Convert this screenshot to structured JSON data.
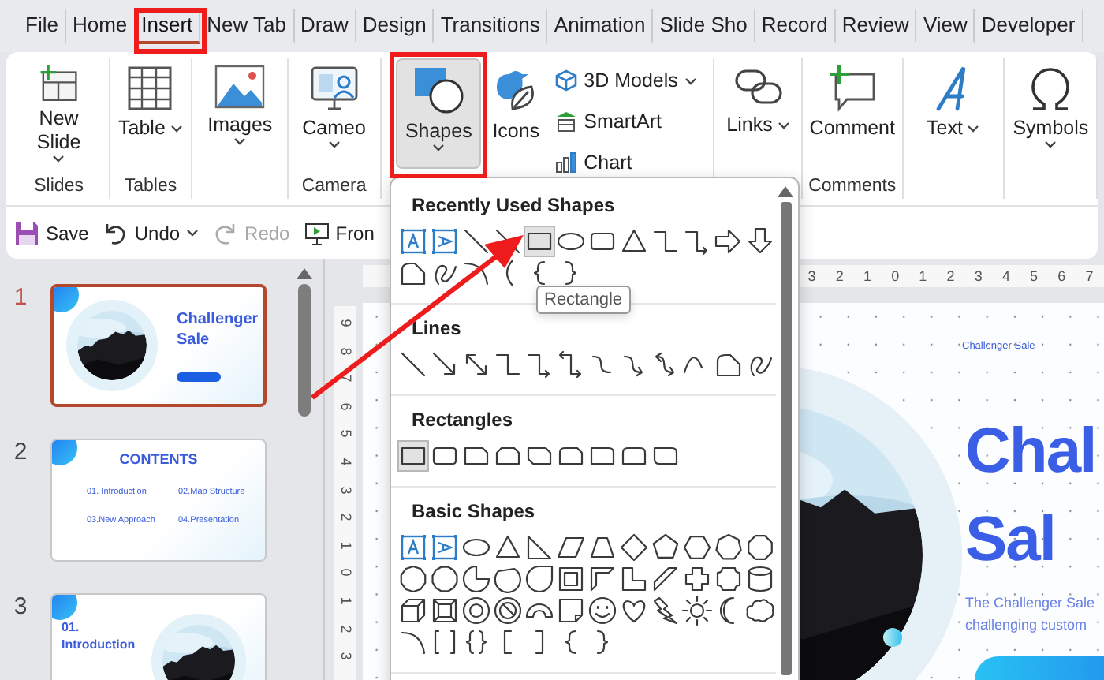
{
  "menu_tabs": [
    {
      "label": "File",
      "selected": false
    },
    {
      "label": "Home",
      "selected": false
    },
    {
      "label": "Insert",
      "selected": true
    },
    {
      "label": "New Tab",
      "selected": false
    },
    {
      "label": "Draw",
      "selected": false
    },
    {
      "label": "Design",
      "selected": false
    },
    {
      "label": "Transitions",
      "selected": false
    },
    {
      "label": "Animation",
      "selected": false
    },
    {
      "label": "Slide Sho",
      "selected": false
    },
    {
      "label": "Record",
      "selected": false
    },
    {
      "label": "Review",
      "selected": false
    },
    {
      "label": "View",
      "selected": false
    },
    {
      "label": "Developer",
      "selected": false
    }
  ],
  "ribbon_groups": [
    {
      "label": "Slides",
      "buttons": [
        {
          "kind": "large",
          "label": "New Slide",
          "dropdown": true,
          "pressed": false
        }
      ]
    },
    {
      "label": "Tables",
      "buttons": [
        {
          "kind": "large",
          "label": "Table",
          "dropdown": true,
          "pressed": false
        }
      ]
    },
    {
      "buttons": [
        {
          "kind": "large",
          "label": "Images",
          "dropdown": true,
          "pressed": false
        }
      ]
    },
    {
      "label": "Camera",
      "buttons": [
        {
          "kind": "large",
          "label": "Cameo",
          "dropdown": true,
          "pressed": false
        }
      ]
    },
    {
      "buttons": [
        {
          "kind": "large",
          "label": "Shapes",
          "dropdown": true,
          "pressed": true
        },
        {
          "kind": "large",
          "label": "Icons",
          "dropdown": false,
          "pressed": false
        },
        {
          "kind": "small",
          "label": "3D Models",
          "dropdown": true,
          "pressed": false
        },
        {
          "kind": "small",
          "label": "SmartArt",
          "dropdown": false,
          "pressed": false
        },
        {
          "kind": "small",
          "label": "Chart",
          "dropdown": false,
          "pressed": false
        }
      ]
    },
    {
      "buttons": [
        {
          "kind": "large",
          "label": "Links",
          "dropdown": true,
          "pressed": false
        }
      ]
    },
    {
      "label": "Comments",
      "buttons": [
        {
          "kind": "large",
          "label": "Comment",
          "dropdown": false,
          "pressed": false
        }
      ]
    },
    {
      "buttons": [
        {
          "kind": "large",
          "label": "Text",
          "dropdown": true,
          "pressed": false
        }
      ]
    },
    {
      "buttons": [
        {
          "kind": "large",
          "label": "Symbols",
          "dropdown": true,
          "pressed": false
        }
      ]
    }
  ],
  "quick_access": [
    {
      "label": "Save",
      "dropdown": false,
      "disabled": false
    },
    {
      "label": "Undo",
      "dropdown": true,
      "disabled": false
    },
    {
      "label": "Redo",
      "dropdown": false,
      "disabled": true
    },
    {
      "label": "Fron",
      "dropdown": false,
      "disabled": false
    }
  ],
  "shapes_menu": {
    "tooltip": "Rectangle",
    "sections": [
      {
        "title": "Recently Used Shapes",
        "shapes": [
          {
            "selected": false
          },
          {
            "selected": false
          },
          {
            "selected": false
          },
          {
            "selected": false
          },
          {
            "selected": true
          },
          {
            "selected": false
          },
          {
            "selected": false
          },
          {
            "selected": false
          },
          {
            "selected": false
          },
          {
            "selected": false
          },
          {
            "selected": false
          },
          {
            "selected": false
          },
          {
            "selected": false
          },
          {
            "selected": false
          },
          {
            "selected": false
          },
          {
            "selected": false
          },
          {
            "selected": false
          },
          {
            "selected": false
          }
        ]
      },
      {
        "title": "Lines",
        "shapes": [
          {
            "selected": false
          },
          {
            "selected": false
          },
          {
            "selected": false
          },
          {
            "selected": false
          },
          {
            "selected": false
          },
          {
            "selected": false
          },
          {
            "selected": false
          },
          {
            "selected": false
          },
          {
            "selected": false
          },
          {
            "selected": false
          },
          {
            "selected": false
          },
          {
            "selected": false
          }
        ]
      },
      {
        "title": "Rectangles",
        "shapes": [
          {
            "selected": true
          },
          {
            "selected": false
          },
          {
            "selected": false
          },
          {
            "selected": false
          },
          {
            "selected": false
          },
          {
            "selected": false
          },
          {
            "selected": false
          },
          {
            "selected": false
          },
          {
            "selected": false
          }
        ]
      },
      {
        "title": "Basic Shapes",
        "shapes": [
          {
            "selected": false
          },
          {
            "selected": false
          },
          {
            "selected": false
          },
          {
            "selected": false
          },
          {
            "selected": false
          },
          {
            "selected": false
          },
          {
            "selected": false
          },
          {
            "selected": false
          },
          {
            "selected": false
          },
          {
            "selected": false
          },
          {
            "selected": false
          },
          {
            "selected": false
          },
          {
            "selected": false
          },
          {
            "selected": false
          },
          {
            "selected": false
          },
          {
            "selected": false
          },
          {
            "selected": false
          },
          {
            "selected": false
          },
          {
            "selected": false
          },
          {
            "selected": false
          },
          {
            "selected": false
          },
          {
            "selected": false
          },
          {
            "selected": false
          },
          {
            "selected": false
          },
          {
            "selected": false
          },
          {
            "selected": false
          },
          {
            "selected": false
          },
          {
            "selected": false
          },
          {
            "selected": false
          },
          {
            "selected": false
          },
          {
            "selected": false
          },
          {
            "selected": false
          },
          {
            "selected": false
          },
          {
            "selected": false
          },
          {
            "selected": false
          },
          {
            "selected": false
          },
          {
            "selected": false
          },
          {
            "selected": false
          },
          {
            "selected": false
          },
          {
            "selected": false
          },
          {
            "selected": false
          },
          {
            "selected": false
          },
          {
            "selected": false
          }
        ]
      }
    ]
  },
  "slides": [
    {
      "number": "1",
      "selected": true,
      "kind": "title",
      "title": "Challenger Sale"
    },
    {
      "number": "2",
      "selected": false,
      "kind": "contents",
      "title": "CONTENTS",
      "items": [
        "01. Introduction",
        "02.Map Structure",
        "03.New Approach",
        "04.Presentation"
      ]
    },
    {
      "number": "3",
      "selected": false,
      "kind": "section",
      "index": "01.",
      "title": "Introduction"
    }
  ],
  "rulers": {
    "horizontal": [
      "3",
      "2",
      "1",
      "0",
      "1",
      "2",
      "3",
      "4",
      "5",
      "6",
      "7"
    ],
    "vertical": [
      "9",
      "8",
      "7",
      "6",
      "5",
      "4",
      "3",
      "2",
      "1",
      "0",
      "1",
      "2",
      "3"
    ]
  },
  "slide": {
    "header": "Challenger Sale",
    "title_lines": [
      "Chal",
      "Sal"
    ],
    "subtitle_lines": [
      "The Challenger Sale",
      "challenging custom"
    ]
  }
}
